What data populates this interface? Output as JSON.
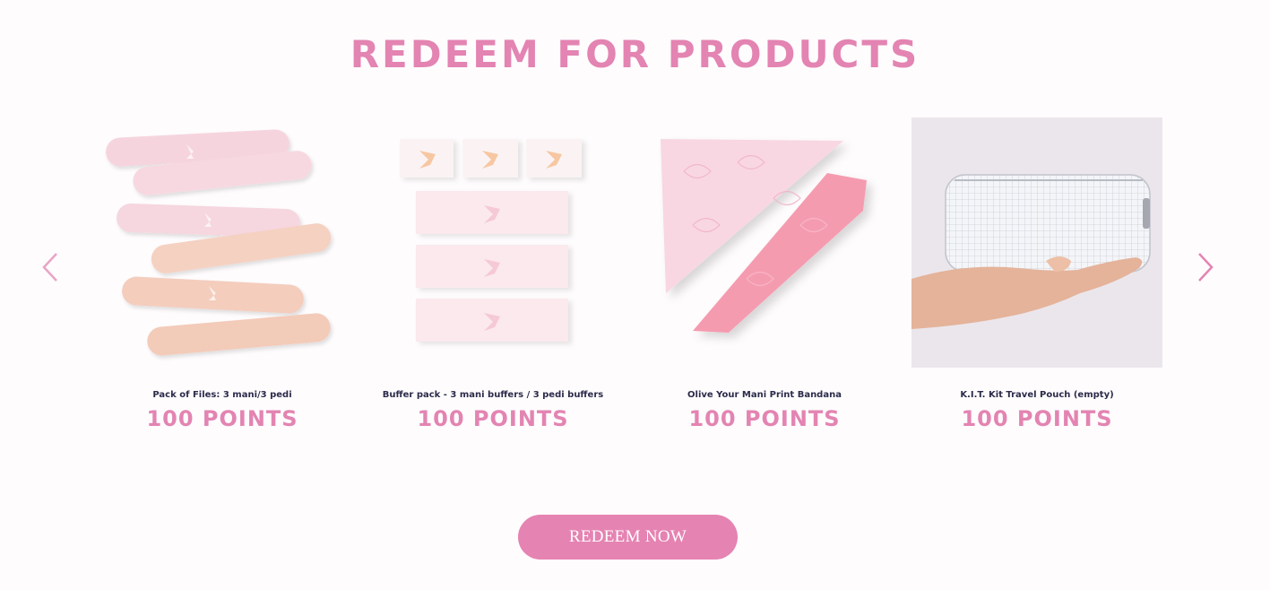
{
  "section": {
    "title": "REDEEM FOR PRODUCTS"
  },
  "carousel": {
    "prev_icon": "chevron-left-icon",
    "next_icon": "chevron-right-icon",
    "products": [
      {
        "name": "Pack of Files: 3 mani/3 pedi",
        "points": "100 POINTS",
        "image": "nail-files-image"
      },
      {
        "name": "Buffer pack - 3 mani buffers / 3 pedi buffers",
        "points": "100 POINTS",
        "image": "buffer-pack-image"
      },
      {
        "name": "Olive Your Mani Print Bandana",
        "points": "100 POINTS",
        "image": "bandana-image"
      },
      {
        "name": "K.I.T. Kit Travel Pouch (empty)",
        "points": "100 POINTS",
        "image": "travel-pouch-image"
      }
    ]
  },
  "cta": {
    "label": "REDEEM NOW"
  },
  "colors": {
    "accent": "#e384b2",
    "button": "#e583b2",
    "product_name": "#2b2b4a",
    "background": "#fefcfd"
  }
}
